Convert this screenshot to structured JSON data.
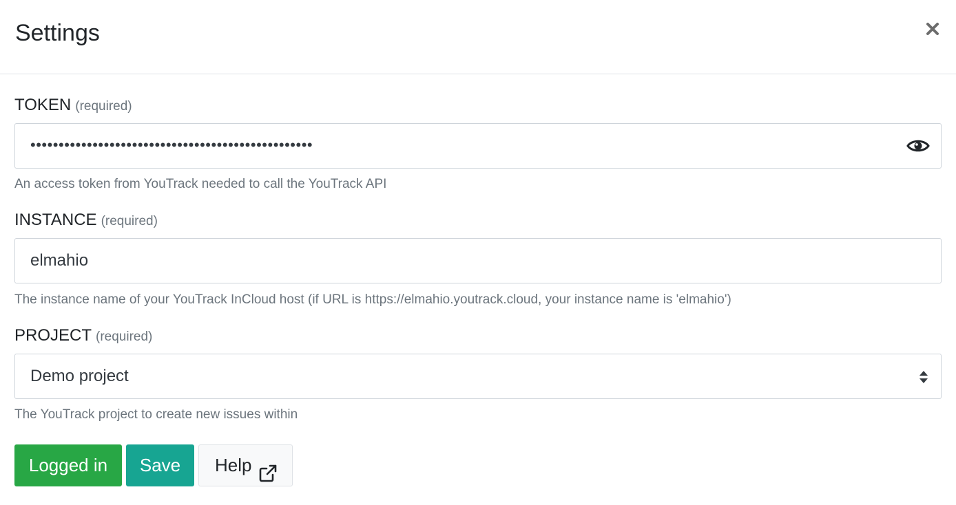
{
  "header": {
    "title": "Settings",
    "close_icon": "close-icon"
  },
  "token": {
    "label": "TOKEN",
    "required": "(required)",
    "value_masked": "••••••••••••••••••••••••••••••••••••••••••••••••••",
    "toggle_icon": "eye-icon",
    "help": "An access token from YouTrack needed to call the YouTrack API"
  },
  "instance": {
    "label": "INSTANCE",
    "required": "(required)",
    "value": "elmahio",
    "help": "The instance name of your YouTrack InCloud host (if URL is https://elmahio.youtrack.cloud, your instance name is 'elmahio')"
  },
  "project": {
    "label": "PROJECT",
    "required": "(required)",
    "selected": "Demo project",
    "arrow_icon": "select-arrows-icon",
    "help": "The YouTrack project to create new issues within"
  },
  "buttons": {
    "logged_in": "Logged in",
    "save": "Save",
    "help": "Help",
    "help_icon": "external-link-icon"
  },
  "colors": {
    "logged_in_bg": "#28a745",
    "save_bg": "#17a592",
    "help_bg": "#f8f9fa",
    "muted_text": "#6c757d"
  }
}
